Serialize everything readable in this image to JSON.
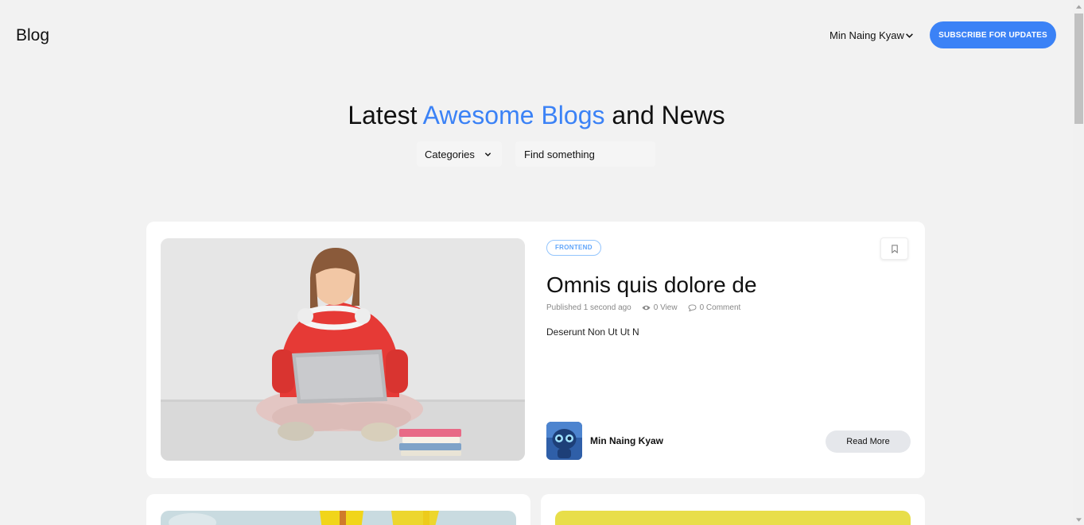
{
  "header": {
    "brand": "Blog",
    "user_name": "Min Naing Kyaw",
    "subscribe_label": "SUBSCRIBE FOR UPDATES"
  },
  "hero": {
    "title_before": "Latest ",
    "title_accent": "Awesome Blogs",
    "title_after": " and News",
    "categories_label": "Categories",
    "search_placeholder": "Find something"
  },
  "featured": {
    "tag": "FRONTEND",
    "title": "Omnis quis dolore de",
    "published": "Published 1 second ago",
    "views": "0 View",
    "comments": "0 Comment",
    "excerpt": "Deserunt Non Ut Ut N",
    "author": "Min Naing Kyaw",
    "read_more": "Read More"
  },
  "colors": {
    "accent": "#3b82f6",
    "background": "#f2f2f2",
    "card": "#ffffff"
  },
  "icons": {
    "user_menu": "chevron-down-icon",
    "categories": "chevron-down-icon",
    "bookmark": "bookmark-icon",
    "views": "eye-icon",
    "comments": "comment-icon"
  }
}
